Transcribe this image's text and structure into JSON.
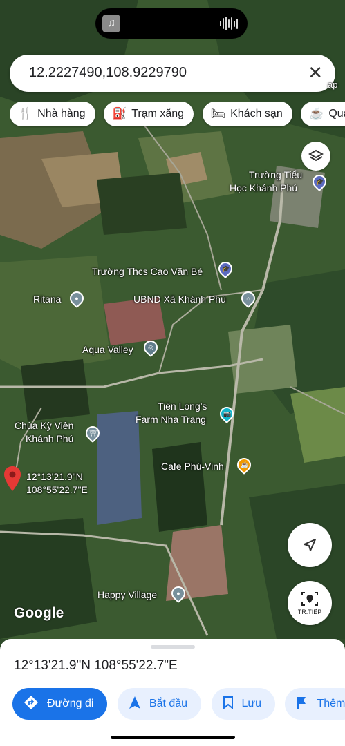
{
  "search": {
    "query": "12.2227490,108.9229790",
    "clear_icon": "close-icon"
  },
  "chips": [
    {
      "label": "Nhà hàng",
      "icon": "restaurant-icon"
    },
    {
      "label": "Trạm xăng",
      "icon": "gas-station-icon"
    },
    {
      "label": "Khách sạn",
      "icon": "hotel-icon"
    },
    {
      "label": "Quán",
      "icon": "cafe-icon"
    }
  ],
  "map": {
    "places": {
      "truong_tieu_hoc_1": "Trường Tiểu",
      "truong_tieu_hoc_2": "Học Khánh Phú",
      "truong_thcs": "Trường Thcs Cao Văn Bé",
      "ubnd": "UBND Xã Khánh Phú",
      "ritana": "Ritana",
      "aqua": "Aqua Valley",
      "chua_1": "Chùa Kỳ Viên",
      "chua_2": "Khánh Phú",
      "tien_long_1": "Tiên Long's",
      "tien_long_2": "Farm Nha Trang",
      "cafe": "Cafe Phú-Vinh",
      "happy": "Happy Village",
      "edge_cut": "ạp"
    },
    "dropped_pin": {
      "lat": "12°13'21.9\"N",
      "lng": "108°55'22.7\"E"
    },
    "attribution": "Google",
    "next_label": "TR.TIẾP"
  },
  "sheet": {
    "coords": "12°13'21.9\"N 108°55'22.7\"E",
    "actions": [
      {
        "label": "Đường đi",
        "icon": "directions-icon"
      },
      {
        "label": "Bắt đầu",
        "icon": "navigation-arrow-icon"
      },
      {
        "label": "Lưu",
        "icon": "bookmark-icon"
      },
      {
        "label": "Thêm",
        "icon": "flag-icon"
      }
    ]
  },
  "colors": {
    "accent": "#1a73e8",
    "chip_bg": "#ffffff",
    "pin_red": "#e53935"
  }
}
